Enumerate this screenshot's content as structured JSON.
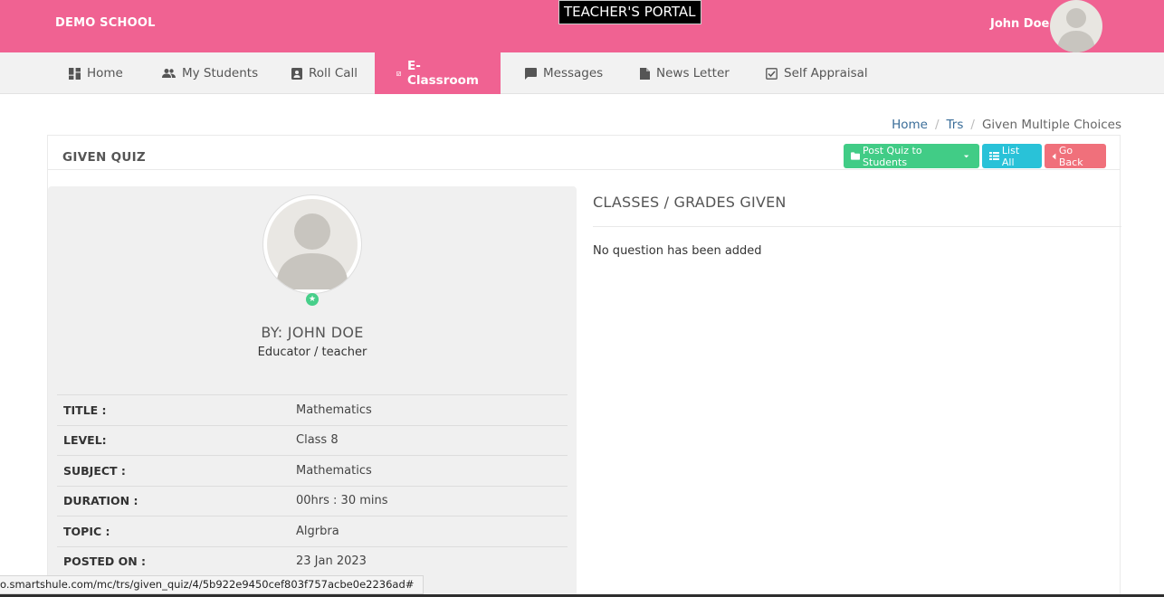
{
  "header": {
    "school": "DEMO SCHOOL",
    "portal": "TEACHER'S PORTAL",
    "user": "John Doe -"
  },
  "nav": {
    "items": [
      {
        "label": "Home",
        "icon": "dashboard-icon"
      },
      {
        "label": "My Students",
        "icon": "people-icon"
      },
      {
        "label": "Roll Call",
        "icon": "contact-card-icon"
      },
      {
        "label": "E-Classroom",
        "icon": "check-square-icon",
        "active": true
      },
      {
        "label": "Messages",
        "icon": "chat-icon"
      },
      {
        "label": "News Letter",
        "icon": "document-icon"
      },
      {
        "label": "Self Appraisal",
        "icon": "checkbox-icon"
      }
    ]
  },
  "breadcrumb": {
    "home": "Home",
    "trs": "Trs",
    "current": "Given Multiple Choices"
  },
  "panel": {
    "title": "GIVEN QUIZ",
    "buttons": {
      "post": "Post Quiz to Students",
      "list": "List All",
      "back": "Go Back"
    }
  },
  "profile": {
    "by": "BY: JOHN DOE",
    "role": "Educator / teacher"
  },
  "details": [
    {
      "label": "TITLE :",
      "value": "Mathematics"
    },
    {
      "label": "LEVEL:",
      "value": "Class 8"
    },
    {
      "label": "SUBJECT :",
      "value": "Mathematics"
    },
    {
      "label": "DURATION :",
      "value": "00hrs : 30 mins"
    },
    {
      "label": "TOPIC :",
      "value": "Algrbra"
    },
    {
      "label": "POSTED ON :",
      "value": "23 Jan 2023"
    }
  ],
  "classes": {
    "title": "CLASSES / GRADES GIVEN",
    "empty": "No question has been added"
  },
  "status_url": "o.smartshule.com/mc/trs/given_quiz/4/5b922e9450cef803f757acbe0e2236ad#",
  "colors": {
    "brand": "#f06292",
    "green": "#41cc86",
    "teal": "#29c2d8",
    "red": "#f0707b"
  }
}
